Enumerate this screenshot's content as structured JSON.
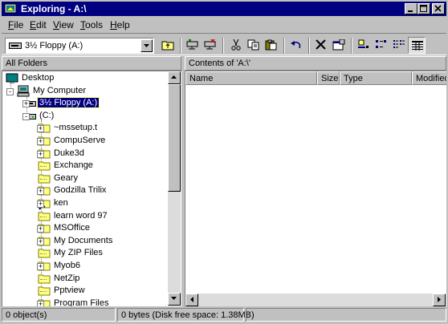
{
  "window": {
    "title": "Exploring - A:\\",
    "minimize_label": "_",
    "maximize_label": "□",
    "close_label": "×"
  },
  "menu": [
    {
      "accel": "F",
      "rest": "ile"
    },
    {
      "accel": "E",
      "rest": "dit"
    },
    {
      "accel": "V",
      "rest": "iew"
    },
    {
      "accel": "T",
      "rest": "ools"
    },
    {
      "accel": "H",
      "rest": "elp"
    }
  ],
  "toolbar": {
    "drive_value": "3½ Floppy (A:)",
    "buttons": [
      "up-one-level-icon",
      "map-network-drive-icon",
      "disconnect-drive-icon",
      "cut-icon",
      "copy-icon",
      "paste-icon",
      "undo-icon",
      "delete-icon",
      "properties-icon",
      "large-icons-icon",
      "small-icons-icon",
      "list-icon",
      "details-icon"
    ]
  },
  "panes": {
    "folders_header": "All Folders",
    "contents_header": "Contents of 'A:\\'"
  },
  "tree": [
    {
      "label": "Desktop",
      "level": 0,
      "icon": "desktop-icon",
      "expander": ""
    },
    {
      "label": "My Computer",
      "level": 1,
      "icon": "computer-icon",
      "expander": "-"
    },
    {
      "label": "3½ Floppy (A:)",
      "level": 2,
      "icon": "floppy-drive-icon",
      "expander": "+",
      "selected": true
    },
    {
      "label": "(C:)",
      "level": 2,
      "icon": "hard-drive-icon",
      "expander": "-"
    },
    {
      "label": "~mssetup.t",
      "level": 3,
      "icon": "folder-icon",
      "expander": "+"
    },
    {
      "label": "CompuServe",
      "level": 3,
      "icon": "folder-icon",
      "expander": "+"
    },
    {
      "label": "Duke3d",
      "level": 3,
      "icon": "folder-icon",
      "expander": "+"
    },
    {
      "label": "Exchange",
      "level": 3,
      "icon": "folder-icon",
      "expander": ""
    },
    {
      "label": "Geary",
      "level": 3,
      "icon": "folder-icon",
      "expander": ""
    },
    {
      "label": "Godzilla Trilix",
      "level": 3,
      "icon": "folder-icon",
      "expander": "+"
    },
    {
      "label": "ken",
      "level": 3,
      "icon": "shared-folder-icon",
      "expander": "+"
    },
    {
      "label": "learn word 97",
      "level": 3,
      "icon": "folder-icon",
      "expander": ""
    },
    {
      "label": "MSOffice",
      "level": 3,
      "icon": "folder-icon",
      "expander": "+"
    },
    {
      "label": "My Documents",
      "level": 3,
      "icon": "folder-icon",
      "expander": "+"
    },
    {
      "label": "My ZIP Files",
      "level": 3,
      "icon": "folder-icon",
      "expander": ""
    },
    {
      "label": "Myob6",
      "level": 3,
      "icon": "folder-icon",
      "expander": "+"
    },
    {
      "label": "NetZip",
      "level": 3,
      "icon": "folder-icon",
      "expander": ""
    },
    {
      "label": "Pptview",
      "level": 3,
      "icon": "folder-icon",
      "expander": ""
    },
    {
      "label": "Program Files",
      "level": 3,
      "icon": "folder-icon",
      "expander": "+"
    }
  ],
  "columns": [
    {
      "key": "name",
      "label": "Name"
    },
    {
      "key": "size",
      "label": "Size"
    },
    {
      "key": "type",
      "label": "Type"
    },
    {
      "key": "modified",
      "label": "Modified"
    }
  ],
  "status": {
    "objects": "0 object(s)",
    "free": "0 bytes (Disk free space: 1.38MB)"
  },
  "colors": {
    "title_bar": "#000080",
    "face": "#c0c0c0",
    "folder": "#ffff80"
  }
}
